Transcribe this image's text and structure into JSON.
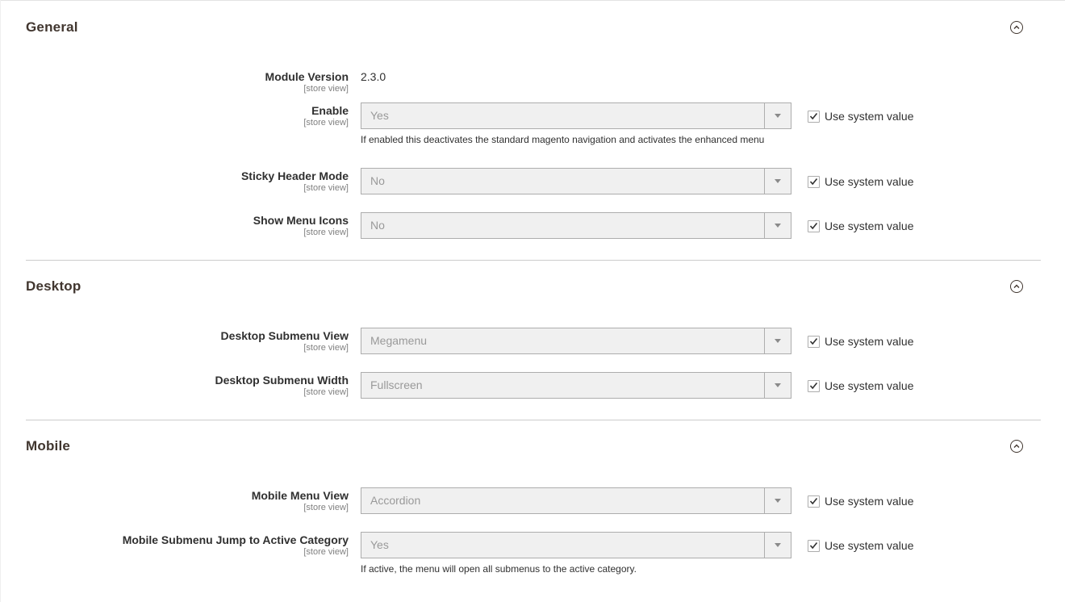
{
  "sections": {
    "general": {
      "title": "General",
      "module_version": {
        "label": "Module Version",
        "scope": "[store view]",
        "value": "2.3.0"
      },
      "enable": {
        "label": "Enable",
        "scope": "[store view]",
        "value": "Yes",
        "system_value_label": "Use system value",
        "system_value_checked": true,
        "note": "If enabled this deactivates the standard magento navigation and activates the enhanced menu"
      },
      "sticky_header_mode": {
        "label": "Sticky Header Mode",
        "scope": "[store view]",
        "value": "No",
        "system_value_label": "Use system value",
        "system_value_checked": true
      },
      "show_menu_icons": {
        "label": "Show Menu Icons",
        "scope": "[store view]",
        "value": "No",
        "system_value_label": "Use system value",
        "system_value_checked": true
      }
    },
    "desktop": {
      "title": "Desktop",
      "submenu_view": {
        "label": "Desktop Submenu View",
        "scope": "[store view]",
        "value": "Megamenu",
        "system_value_label": "Use system value",
        "system_value_checked": true
      },
      "submenu_width": {
        "label": "Desktop Submenu Width",
        "scope": "[store view]",
        "value": "Fullscreen",
        "system_value_label": "Use system value",
        "system_value_checked": true
      }
    },
    "mobile": {
      "title": "Mobile",
      "menu_view": {
        "label": "Mobile Menu View",
        "scope": "[store view]",
        "value": "Accordion",
        "system_value_label": "Use system value",
        "system_value_checked": true
      },
      "jump_active": {
        "label": "Mobile Submenu Jump to Active Category",
        "scope": "[store view]",
        "value": "Yes",
        "system_value_label": "Use system value",
        "system_value_checked": true,
        "note": "If active, the menu will open all submenus to the active category."
      }
    }
  },
  "icons": {
    "collapse": "chevron-up-circle-icon",
    "check": "checkmark-icon",
    "dropdown": "dropdown-arrow-icon"
  }
}
